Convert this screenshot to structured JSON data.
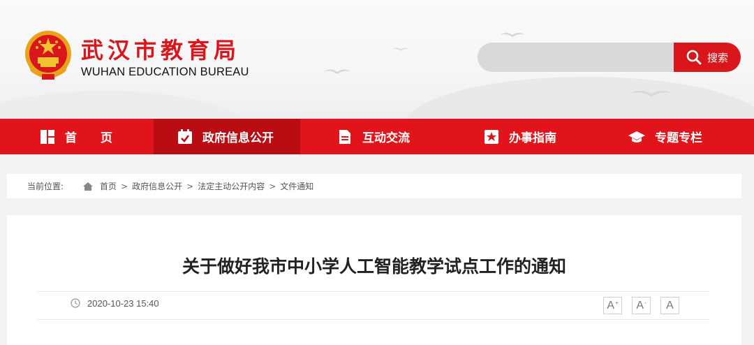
{
  "header": {
    "name_cn": "武汉市教育局",
    "name_en": "WUHAN EDUCATION BUREAU",
    "logo_icon": "national-emblem-icon",
    "brand_color": "#d8161b"
  },
  "search": {
    "value": "",
    "placeholder": "",
    "button_label": "搜索",
    "icon": "search-icon"
  },
  "nav": {
    "items": [
      {
        "label": "首　　页",
        "icon": "home-grid-icon"
      },
      {
        "label": "政府信息公开",
        "icon": "calendar-check-icon",
        "active": true
      },
      {
        "label": "互动交流",
        "icon": "document-icon"
      },
      {
        "label": "办事指南",
        "icon": "star-bookmark-icon"
      },
      {
        "label": "专题专栏",
        "icon": "graduation-cap-icon"
      }
    ]
  },
  "breadcrumb": {
    "lead": "当前位置:",
    "items": [
      "首页",
      "政府信息公开",
      "法定主动公开内容",
      "文件通知"
    ],
    "separator": ">"
  },
  "article": {
    "title": "关于做好我市中小学人工智能教学试点工作的通知",
    "date": "2020-10-23 15:40",
    "font_buttons": [
      "A+",
      "A-",
      "A"
    ]
  }
}
